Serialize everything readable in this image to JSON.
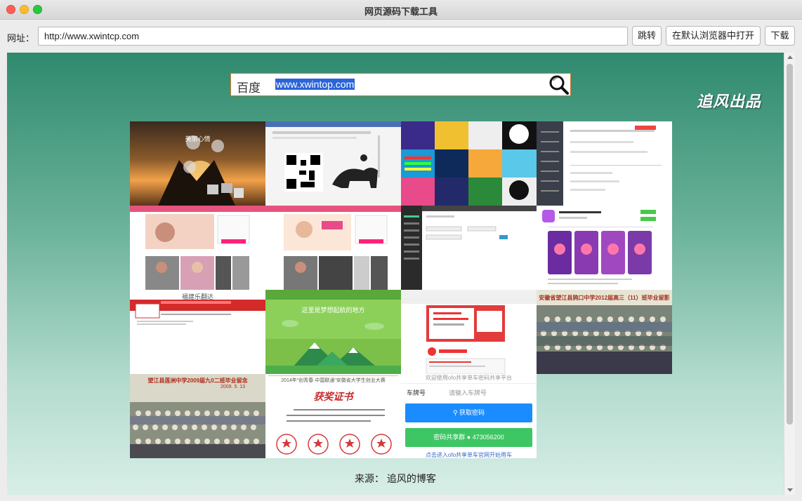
{
  "window": {
    "title": "网页源码下载工具"
  },
  "toolbar": {
    "url_label": "网址：",
    "url_value": "http://www.xwintcp.com",
    "go_label": "跳转",
    "open_browser_label": "在默认浏览器中打开",
    "download_label": "下载"
  },
  "page": {
    "search": {
      "engine": "百度",
      "query": "www.xwintop.com"
    },
    "brand": "追风出品",
    "source_text": "来源： 追风的博客",
    "tiles": {
      "t1": {
        "label": "美丽心情"
      },
      "t9": {
        "label": "福建乐翻达"
      },
      "t10": {
        "label": "这里是梦想起航的地方"
      },
      "t12": {
        "label": "安徽省望江县鸦口中学2012届高三（11）班毕业留影"
      },
      "t13": {
        "label": "望江县莲洲中学2009届九0二班毕业留念",
        "date": "2009. 5. 13"
      },
      "t14": {
        "header": "2014年“创青春·中国联通”安徽省大学生创业大赛",
        "title": "获奖证书"
      },
      "t15": {
        "header": "欢迎使用ofo共享单车密码共享平台",
        "plate_label": "车牌号",
        "plate_placeholder": "请输入车牌号",
        "get_code": "获取密码",
        "share_group": "密码共享群",
        "share_number": "473056200",
        "footer": "点击进入ofo共享单车官网开始用车"
      }
    }
  },
  "colors": {
    "bg_top": "#2f8a6e",
    "bg_bottom": "#d8eee7",
    "search_highlight": "#2a64d8",
    "ofo_blue": "#1a8cff",
    "ofo_green": "#3ec665"
  }
}
